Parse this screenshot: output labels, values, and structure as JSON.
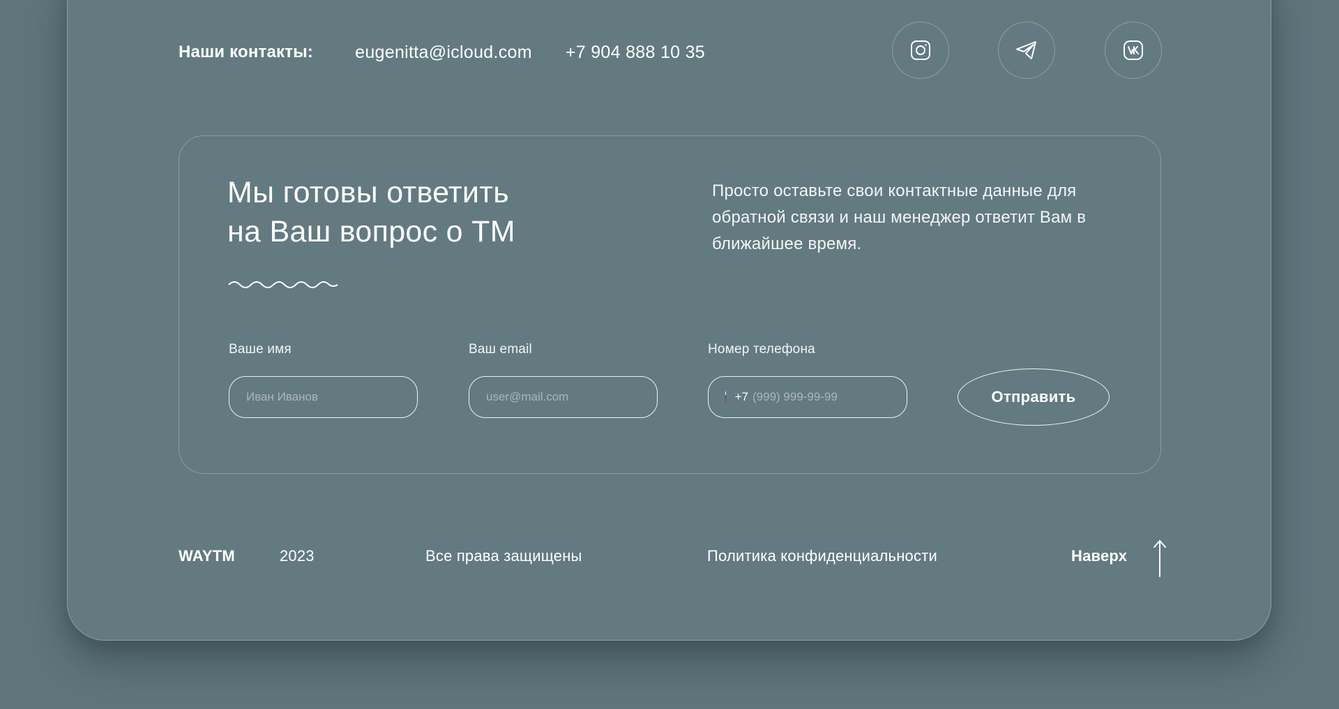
{
  "contacts": {
    "label": "Наши контакты:",
    "email": "eugenitta@icloud.com",
    "phone": "+7 904 888 10 35"
  },
  "social": [
    {
      "name": "instagram",
      "icon": "instagram-icon"
    },
    {
      "name": "telegram",
      "icon": "telegram-icon"
    },
    {
      "name": "vk",
      "icon": "vk-icon"
    }
  ],
  "form": {
    "headline_line1": "Мы готовы ответить",
    "headline_line2": "на Ваш вопрос о ТМ",
    "description": "Просто оставьте свои контактные данные для обратной связи и наш менеджер ответит Вам в ближайшее время.",
    "name_label": "Ваше имя",
    "name_placeholder": "Иван Иванов",
    "email_label": "Ваш email",
    "email_placeholder": "user@mail.com",
    "phone_label": "Номер телефона",
    "phone_code": "+7",
    "phone_placeholder": "(999) 999-99-99",
    "submit_label": "Отправить"
  },
  "footer": {
    "brand": "WAYTM",
    "year": "2023",
    "rights": "Все права защищены",
    "privacy": "Политика конфиденциальности",
    "up_label": "Наверх"
  },
  "colors": {
    "background": "#5f767d",
    "panel": "#637a81",
    "text": "#ffffff"
  }
}
